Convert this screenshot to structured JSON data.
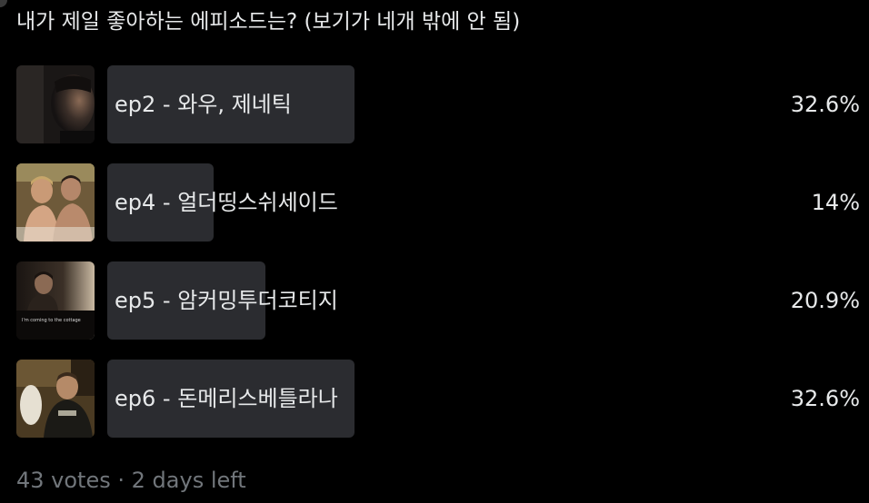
{
  "poll": {
    "question": "내가 제일 좋아하는 에피소드는? (보기가 네개 밖에 안 됨)",
    "options": [
      {
        "label": "ep2 - 와우, 제네틱",
        "percent": "32.6%",
        "share": 32.6
      },
      {
        "label": "ep4 - 얼더띵스쉬세이드",
        "percent": "14%",
        "share": 14
      },
      {
        "label": "ep5 - 암커밍투더코티지",
        "percent": "20.9%",
        "share": 20.9,
        "thumb_caption": "I'm coming to the cottage"
      },
      {
        "label": "ep6 - 돈메리스베틀라나",
        "percent": "32.6%",
        "share": 32.6
      }
    ],
    "votes_text": "43 votes",
    "separator": "·",
    "time_left_text": "2 days left"
  },
  "colors": {
    "background": "#000000",
    "bar": "#2b2c30",
    "text": "#e7e9ea",
    "muted": "#71767b"
  }
}
